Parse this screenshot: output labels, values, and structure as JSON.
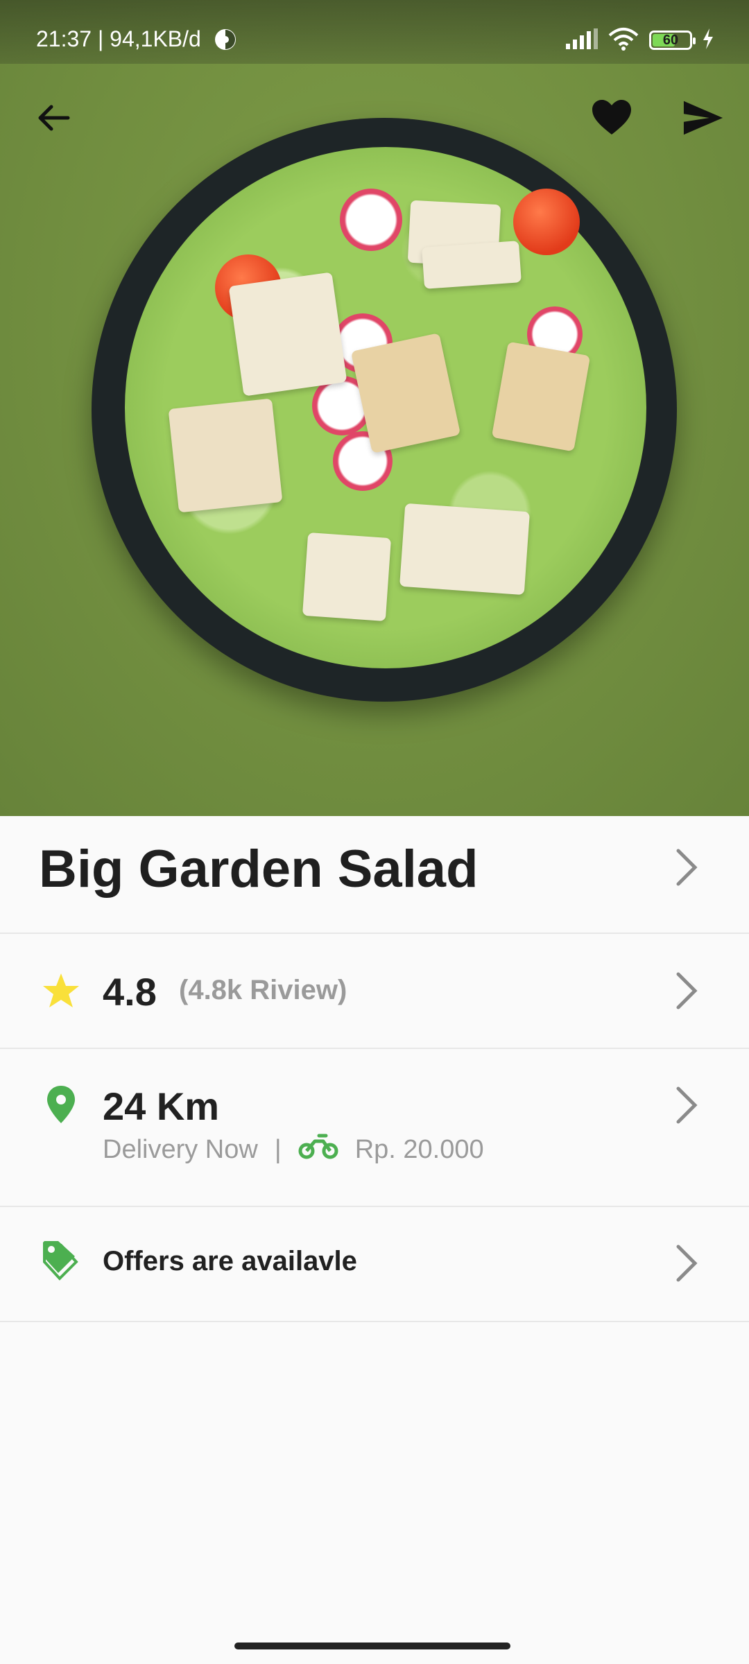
{
  "status_bar": {
    "time": "21:37 | 94,1KB/d",
    "battery_level": "60"
  },
  "hero": {
    "image_icon": "salad-bowl-photo"
  },
  "product": {
    "name": "Big Garden Salad"
  },
  "rating": {
    "value": "4.8",
    "reviews": "(4.8k Riview)",
    "icon": "star-icon",
    "icon_color": "#F9E03A"
  },
  "distance": {
    "value": "24 Km",
    "delivery_label": "Delivery Now",
    "separator": "|",
    "delivery_fee": "Rp. 20.000",
    "icon": "location-pin-icon",
    "accent_color": "#4CAF50"
  },
  "offers": {
    "label": "Offers are availavle",
    "icon": "tag-icon"
  }
}
